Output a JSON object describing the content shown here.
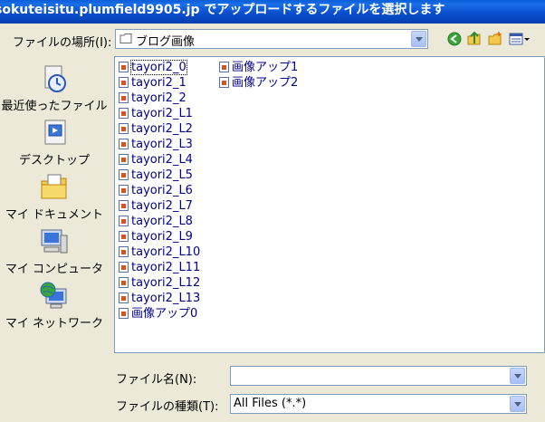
{
  "title": "sokuteisitu.plumfield9905.jp でアップロードするファイルを選択します",
  "lookin": {
    "label": "ファイルの場所(I):",
    "value": "ブログ画像"
  },
  "places": [
    {
      "label": "最近使ったファイル",
      "icon": "recent-documents-icon"
    },
    {
      "label": "デスクトップ",
      "icon": "desktop-icon"
    },
    {
      "label": "マイ ドキュメント",
      "icon": "my-documents-icon"
    },
    {
      "label": "マイ コンピュータ",
      "icon": "my-computer-icon"
    },
    {
      "label": "マイ ネットワーク",
      "icon": "my-network-icon"
    }
  ],
  "files_col1": [
    "tayori2_0",
    "tayori2_1",
    "tayori2_2",
    "tayori2_L1",
    "tayori2_L2",
    "tayori2_L3",
    "tayori2_L4",
    "tayori2_L5",
    "tayori2_L6",
    "tayori2_L7",
    "tayori2_L8",
    "tayori2_L9",
    "tayori2_L10",
    "tayori2_L11",
    "tayori2_L12",
    "tayori2_L13",
    "画像アップ0"
  ],
  "files_col2": [
    "画像アップ1",
    "画像アップ2"
  ],
  "filename": {
    "label": "ファイル名(N):",
    "value": ""
  },
  "filetype": {
    "label": "ファイルの種類(T):",
    "value": "All Files (*.*)"
  },
  "colors": {
    "titlebar": "#0a4fcf",
    "dialog_bg": "#ece9d8",
    "file_text": "#00008b",
    "border": "#7f9db9"
  }
}
